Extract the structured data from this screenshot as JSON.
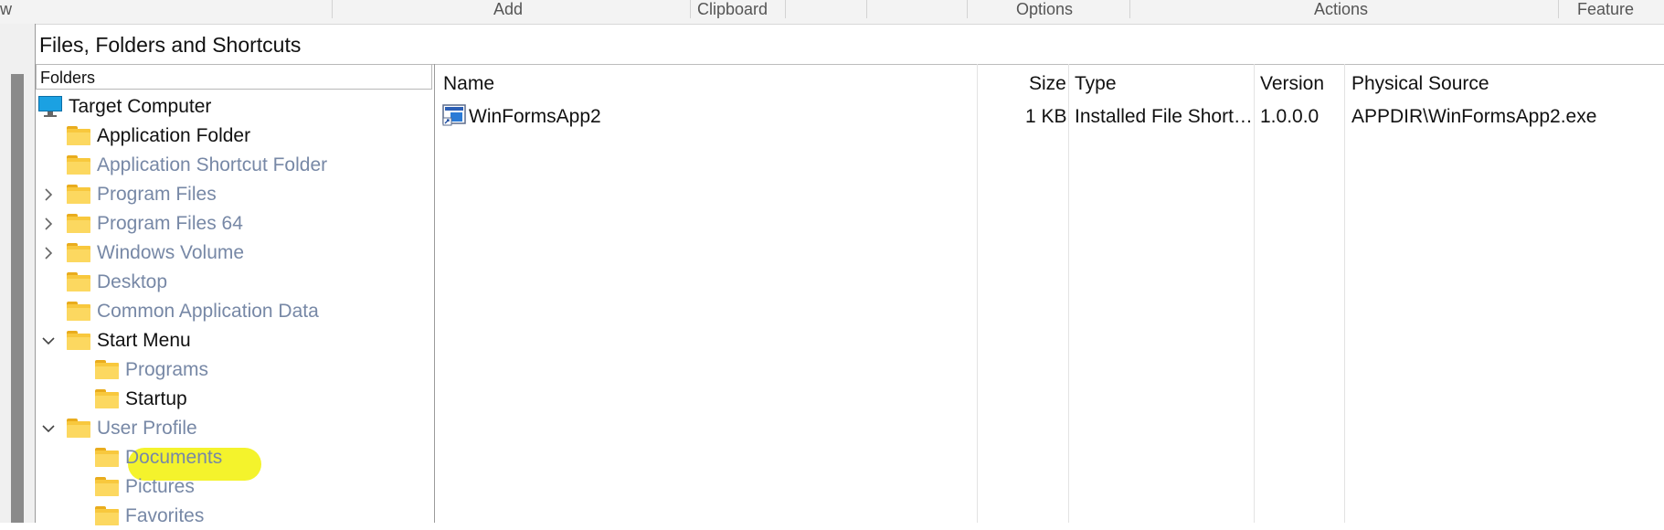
{
  "ribbon": {
    "groups": [
      {
        "label": "w"
      },
      {
        "label": "Add"
      },
      {
        "label": "Clipboard"
      },
      {
        "label": "Options"
      },
      {
        "label": "Actions"
      },
      {
        "label": "Feature"
      }
    ]
  },
  "view": {
    "title": "Files, Folders and Shortcuts"
  },
  "tree": {
    "header": "Folders",
    "items": [
      {
        "label": "Target Computer"
      },
      {
        "label": "Application Folder"
      },
      {
        "label": "Application Shortcut Folder"
      },
      {
        "label": "Program Files"
      },
      {
        "label": "Program Files 64"
      },
      {
        "label": "Windows Volume"
      },
      {
        "label": "Desktop"
      },
      {
        "label": "Common Application Data"
      },
      {
        "label": "Start Menu"
      },
      {
        "label": "Programs"
      },
      {
        "label": "Startup"
      },
      {
        "label": "User Profile"
      },
      {
        "label": "Documents"
      },
      {
        "label": "Pictures"
      },
      {
        "label": "Favorites"
      }
    ]
  },
  "files": {
    "columns": {
      "name": "Name",
      "size": "Size",
      "type": "Type",
      "version": "Version",
      "source": "Physical Source"
    },
    "rows": [
      {
        "name": "WinFormsApp2",
        "size": "1 KB",
        "type": "Installed File Short…",
        "version": "1.0.0.0",
        "source": "APPDIR\\WinFormsApp2.exe"
      }
    ]
  },
  "colors": {
    "highlight": "#f3f21a",
    "folder": "#f8c83d",
    "dim_text": "#7788a6"
  }
}
